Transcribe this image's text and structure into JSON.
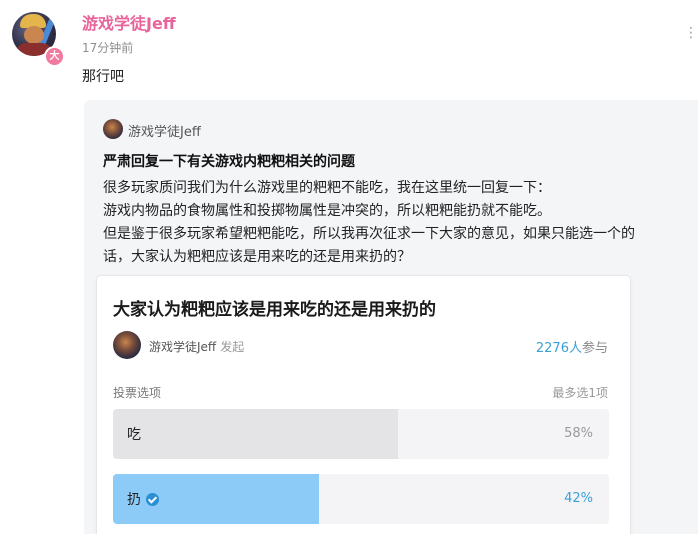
{
  "post": {
    "author": "游戏学徒Jeff",
    "time": "17分钟前",
    "text": "那行吧",
    "badge": "大"
  },
  "quote": {
    "author": "游戏学徒Jeff",
    "title": "严肃回复一下有关游戏内粑粑相关的问题",
    "lines": [
      "很多玩家质问我们为什么游戏里的粑粑不能吃，我在这里统一回复一下：",
      "游戏内物品的食物属性和投掷物属性是冲突的，所以粑粑能扔就不能吃。",
      "但是鉴于很多玩家希望粑粑能吃，所以我再次征求一下大家的意见，如果只能选一个的",
      "话，大家认为粑粑应该是用来吃的还是用来扔的？"
    ]
  },
  "poll": {
    "title": "大家认为粑粑应该是用来吃的还是用来扔的",
    "author": "游戏学徒Jeff",
    "author_suffix": "发起",
    "participants_count": "2276人",
    "participants_label": "参与",
    "options_label": "投票选项",
    "max_choice": "最多选1项",
    "options": [
      {
        "label": "吃",
        "percent_text": "58%",
        "fraction": 0.575,
        "selected": false,
        "fill_color": "#e4e4e6",
        "pct_color": "#999999"
      },
      {
        "label": "扔",
        "percent_text": "42%",
        "fraction": 0.415,
        "selected": true,
        "fill_color": "#8ccbf7",
        "pct_color": "#3aa0d8"
      }
    ]
  },
  "colors": {
    "author_pink": "#e8649b",
    "accent_blue": "#3aa0d8"
  },
  "icons": {
    "more": "more-dots-icon",
    "check": "check-circle-icon"
  }
}
